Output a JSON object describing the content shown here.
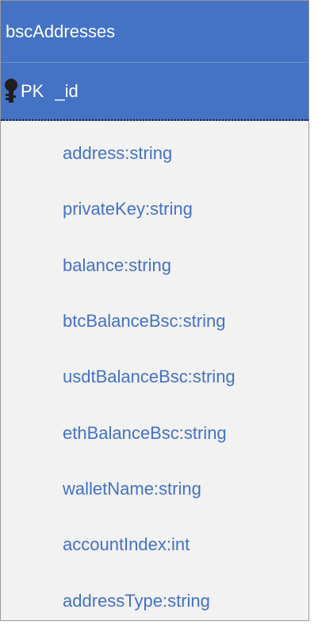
{
  "entity": {
    "name": "bscAddresses",
    "primary_key": {
      "label": "PK",
      "field": "_id",
      "icon": "key-icon"
    },
    "fields": [
      "address:string",
      "privateKey:string",
      "balance:string",
      "btcBalanceBsc:string",
      "usdtBalanceBsc:string",
      "ethBalanceBsc:string",
      "walletName:string",
      "accountIndex:int",
      "addressType:string"
    ]
  },
  "colors": {
    "header_bg": "#4472c4",
    "header_text": "#ffffff",
    "field_text": "#4472c4",
    "body_bg": "#f2f2f2",
    "border": "#9a9a9a"
  }
}
